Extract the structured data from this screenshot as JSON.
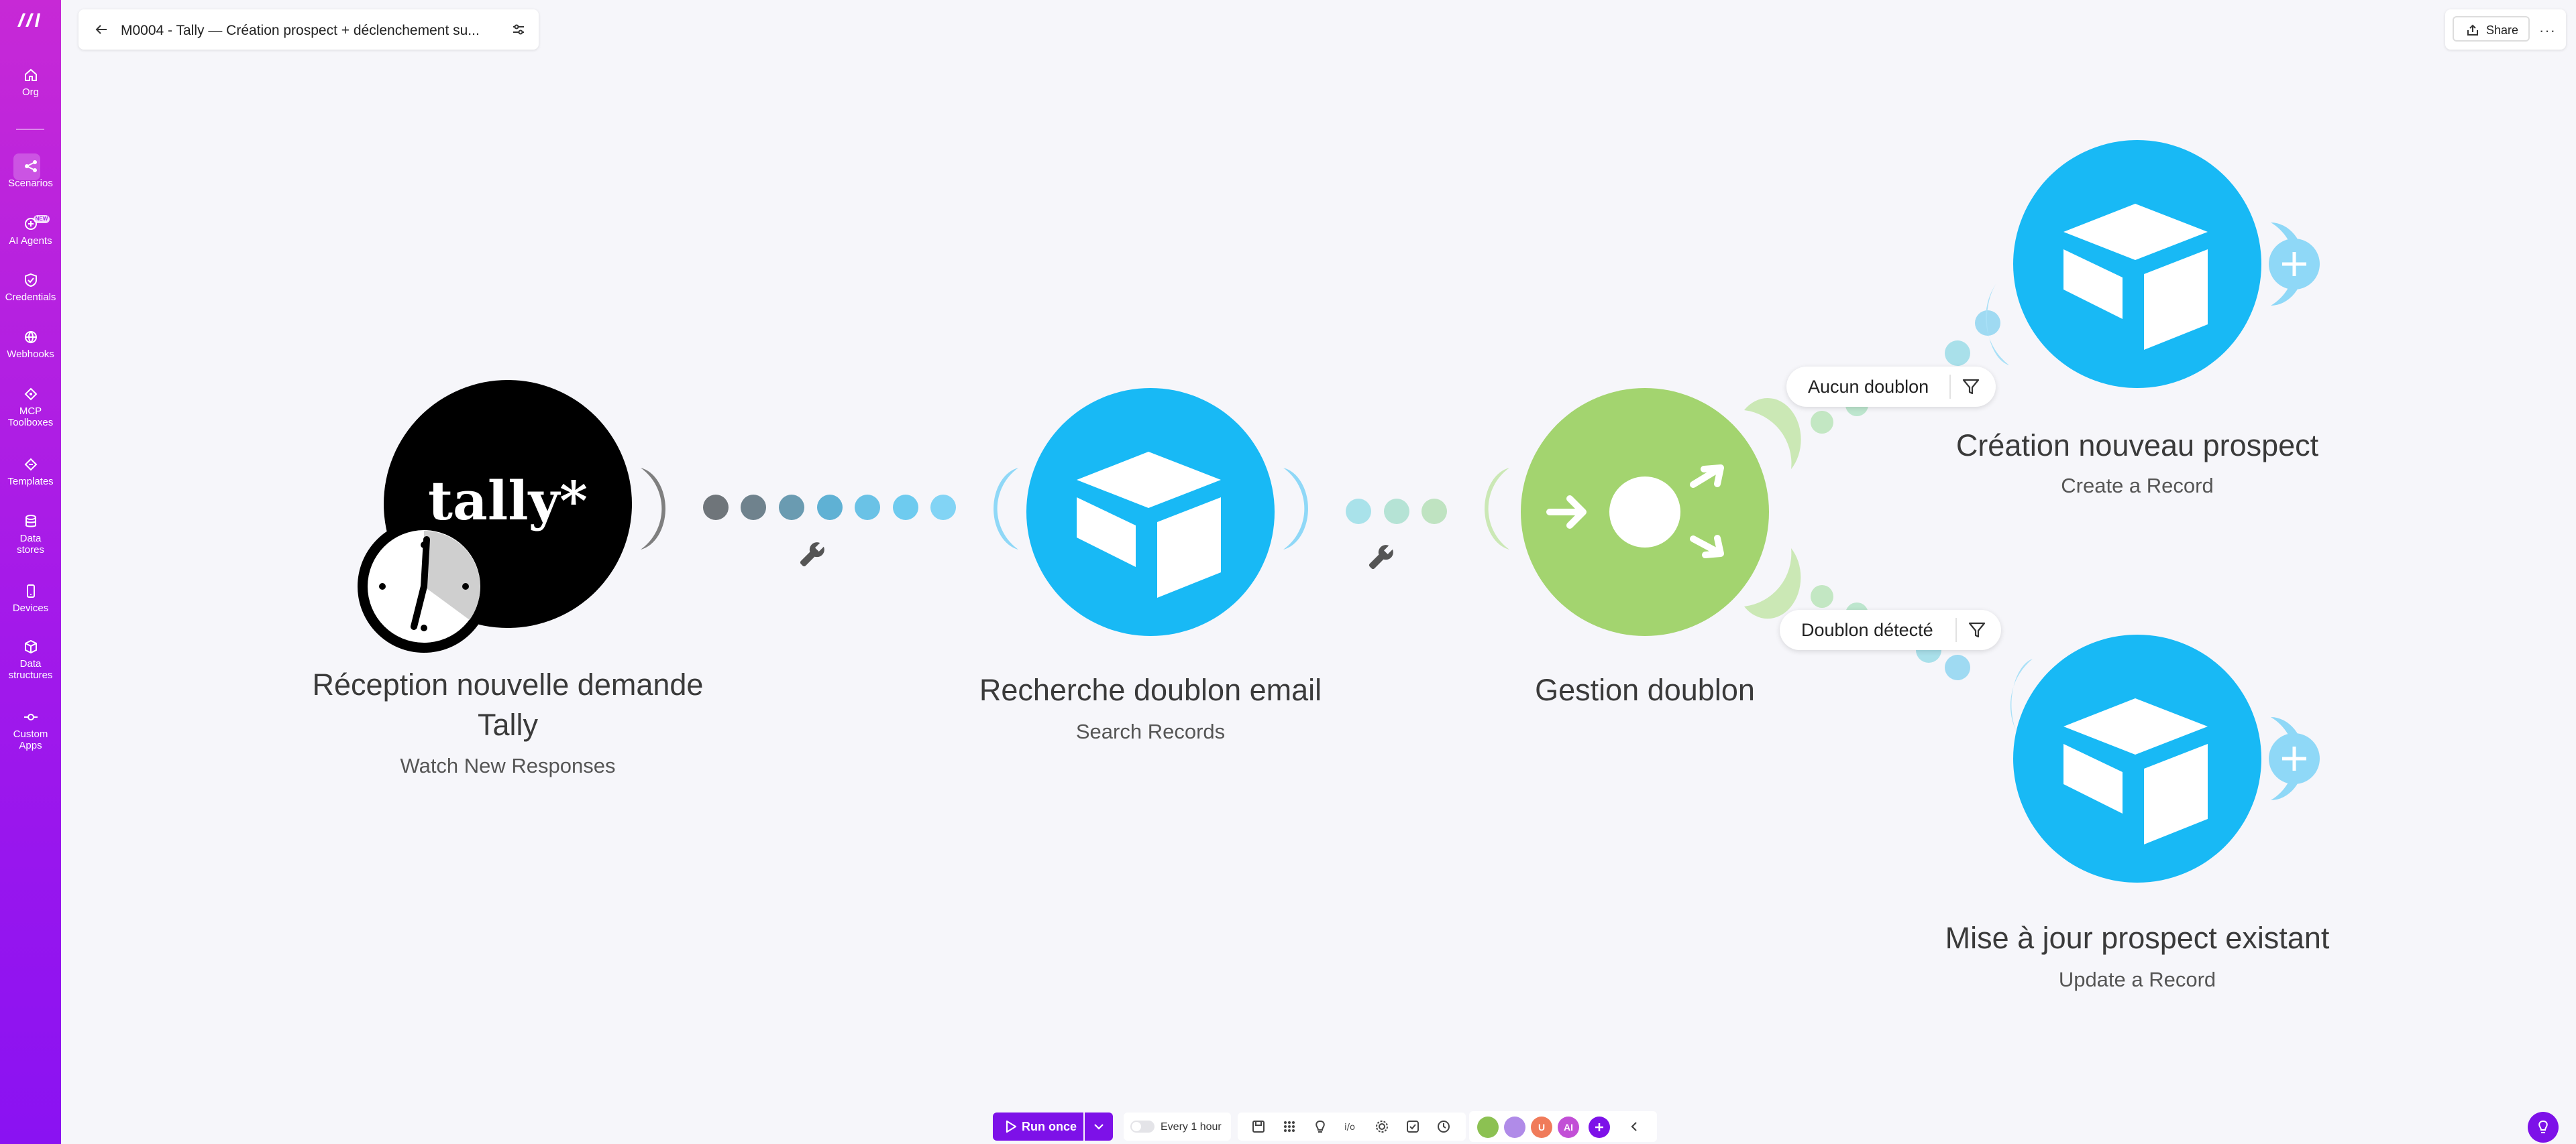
{
  "sidebar": {
    "items": [
      {
        "label": "Org",
        "icon": "home-icon"
      },
      {
        "label": "Scenarios",
        "icon": "share-nodes-icon"
      },
      {
        "label": "AI Agents",
        "icon": "ai-agent-icon",
        "badge": "NEW"
      },
      {
        "label": "Credentials",
        "icon": "shield-check-icon"
      },
      {
        "label": "Webhooks",
        "icon": "globe-icon"
      },
      {
        "label": "MCP\nToolboxes",
        "icon": "mcp-icon"
      },
      {
        "label": "Templates",
        "icon": "templates-icon"
      },
      {
        "label": "Data\nstores",
        "icon": "database-icon"
      },
      {
        "label": "Devices",
        "icon": "phone-icon"
      },
      {
        "label": "Data\nstructures",
        "icon": "cube-icon"
      },
      {
        "label": "Custom\nApps",
        "icon": "custom-apps-icon"
      }
    ]
  },
  "header": {
    "title": "M0004 - Tally — Création prospect + déclenchement su...",
    "share_label": "Share",
    "more_label": "···"
  },
  "modules": [
    {
      "title": "Réception nouvelle demande Tally",
      "subtitle": "Watch New Responses",
      "app": "tally*"
    },
    {
      "title": "Recherche doublon email",
      "subtitle": "Search Records"
    },
    {
      "title": "Gestion doublon",
      "subtitle": ""
    },
    {
      "title": "Création nouveau prospect",
      "subtitle": "Create a Record"
    },
    {
      "title": "Mise à jour prospect existant",
      "subtitle": "Update a Record"
    }
  ],
  "filters": [
    {
      "label": "Aucun doublon"
    },
    {
      "label": "Doublon détecté"
    }
  ],
  "toolbar": {
    "run_label": "Run once",
    "schedule_label": "Every 1 hour",
    "avatars": [
      "",
      "",
      "U",
      "AI"
    ]
  },
  "colors": {
    "sidebar_start": "#c729d6",
    "sidebar_end": "#8a12f2",
    "tally": "#000000",
    "airtable_blue": "#18b9f5",
    "router_green": "#9fd16e",
    "accent_purple": "#7d11e8"
  }
}
